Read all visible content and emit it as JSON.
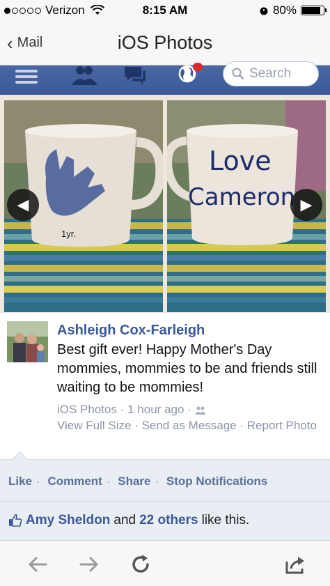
{
  "status_bar": {
    "carrier": "Verizon",
    "time": "8:15 AM",
    "battery": "80%",
    "battery_level": 0.8
  },
  "nav": {
    "back_label": "Mail",
    "title": "iOS Photos"
  },
  "fb_toolbar": {
    "search_placeholder": "Search",
    "accent": "#3b5998",
    "icons": [
      "menu-icon",
      "friend-requests-icon",
      "messages-icon",
      "notifications-globe-icon"
    ]
  },
  "photos": {
    "left_mug_text": "1yr.",
    "right_mug_word1": "Love",
    "right_mug_word2": "Cameron"
  },
  "post": {
    "author": "Ashleigh Cox-Farleigh",
    "caption": "Best gift ever! Happy Mother's Day mommies, mommies to be and friends still waiting to be mommies!",
    "source": "iOS Photos",
    "time": "1 hour ago",
    "links": [
      "View Full Size",
      "Send as Message",
      "Report Photo"
    ]
  },
  "actions": {
    "like": "Like",
    "comment": "Comment",
    "share": "Share",
    "stop_notifications": "Stop Notifications"
  },
  "likes": {
    "name": "Amy Sheldon",
    "and": "and",
    "others": "22 others",
    "suffix": "like this."
  },
  "toolbar": {
    "icons": [
      "back-arrow-icon",
      "forward-arrow-icon",
      "reload-icon",
      "share-icon"
    ]
  }
}
